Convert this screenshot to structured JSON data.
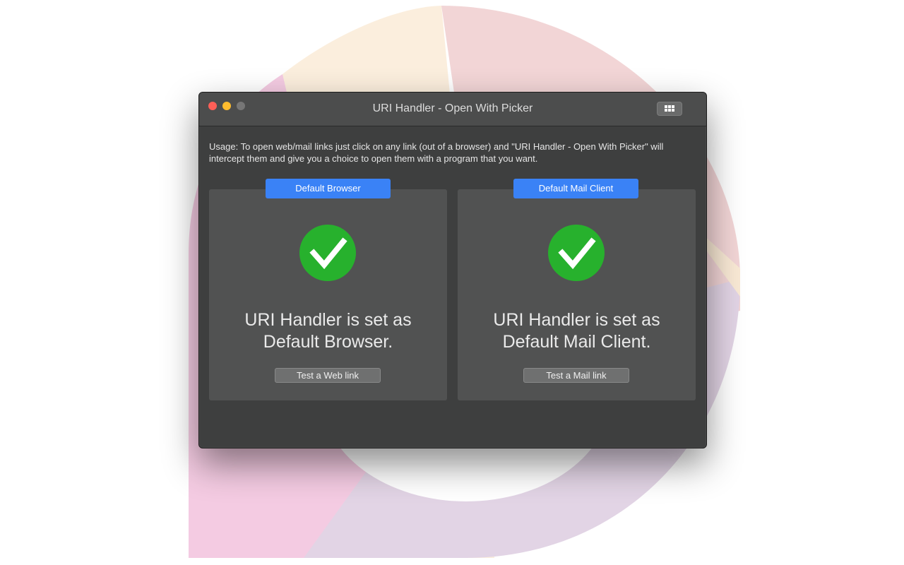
{
  "window": {
    "title": "URI Handler - Open With Picker"
  },
  "usage_text": "Usage: To open web/mail links just click on any link (out of a browser) and \"URI Handler - Open With Picker\" will intercept them and give you a choice to open them with a program that you want.",
  "browser_panel": {
    "tab_label": "Default Browser",
    "status_line1": "URI Handler is set as",
    "status_line2": "Default Browser.",
    "test_button_label": "Test a Web link"
  },
  "mail_panel": {
    "tab_label": "Default Mail Client",
    "status_line1": "URI Handler is set as",
    "status_line2": "Default Mail Client.",
    "test_button_label": "Test a Mail link"
  },
  "icons": {
    "window_menu": "grid-icon",
    "status": "checkmark-icon"
  },
  "colors": {
    "accent": "#3a82f6",
    "success": "#27b12d",
    "close": "#fe5f57",
    "minimize": "#febc2e"
  }
}
